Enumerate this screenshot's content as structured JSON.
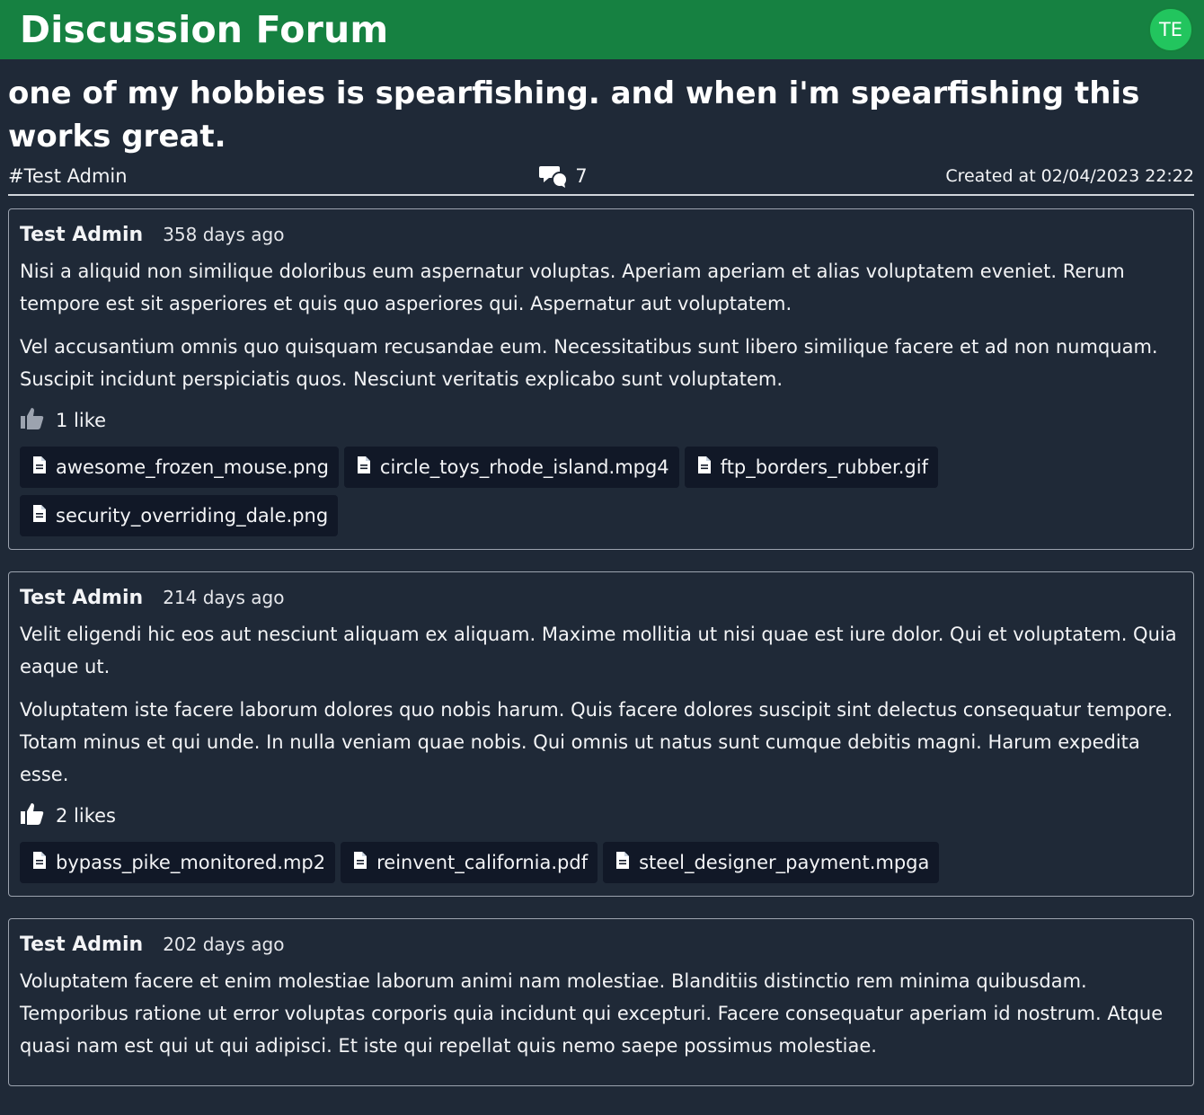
{
  "app": {
    "title": "Discussion Forum",
    "user_initials": "TE",
    "brand_color": "#168141"
  },
  "thread": {
    "title": "one of my hobbies is spearfishing. and when i'm spearfishing this works great.",
    "tag": "#Test Admin",
    "comment_count": "7",
    "created": "Created at 02/04/2023 22:22"
  },
  "posts": [
    {
      "author": "Test Admin",
      "age": "358 days ago",
      "paragraphs": [
        "Nisi a aliquid non similique doloribus eum aspernatur voluptas. Aperiam aperiam et alias voluptatem eveniet. Rerum tempore est sit asperiores et quis quo asperiores qui. Aspernatur aut voluptatem.",
        "Vel accusantium omnis quo quisquam recusandae eum. Necessitatibus sunt libero similique facere et ad non numquam. Suscipit incidunt perspiciatis quos. Nesciunt veritatis explicabo sunt voluptatem."
      ],
      "likes": "1 like",
      "liked": false,
      "attachments": [
        "awesome_frozen_mouse.png",
        "circle_toys_rhode_island.mpg4",
        "ftp_borders_rubber.gif",
        "security_overriding_dale.png"
      ]
    },
    {
      "author": "Test Admin",
      "age": "214 days ago",
      "paragraphs": [
        "Velit eligendi hic eos aut nesciunt aliquam ex aliquam. Maxime mollitia ut nisi quae est iure dolor. Qui et voluptatem. Quia eaque ut.",
        "Voluptatem iste facere laborum dolores quo nobis harum. Quis facere dolores suscipit sint delectus consequatur tempore. Totam minus et qui unde. In nulla veniam quae nobis. Qui omnis ut natus sunt cumque debitis magni. Harum expedita esse."
      ],
      "likes": "2 likes",
      "liked": true,
      "attachments": [
        "bypass_pike_monitored.mp2",
        "reinvent_california.pdf",
        "steel_designer_payment.mpga"
      ]
    },
    {
      "author": "Test Admin",
      "age": "202 days ago",
      "paragraphs": [
        "Voluptatem facere et enim molestiae laborum animi nam molestiae. Blanditiis distinctio rem minima quibusdam. Temporibus ratione ut error voluptas corporis quia incidunt qui excepturi. Facere consequatur aperiam id nostrum. Atque quasi nam est qui ut qui adipisci. Et iste qui repellat quis nemo saepe possimus molestiae."
      ],
      "likes": "",
      "liked": false,
      "attachments": []
    }
  ],
  "icons": {
    "comments": "comments-icon",
    "like": "thumbs-up-icon",
    "file": "file-icon"
  }
}
